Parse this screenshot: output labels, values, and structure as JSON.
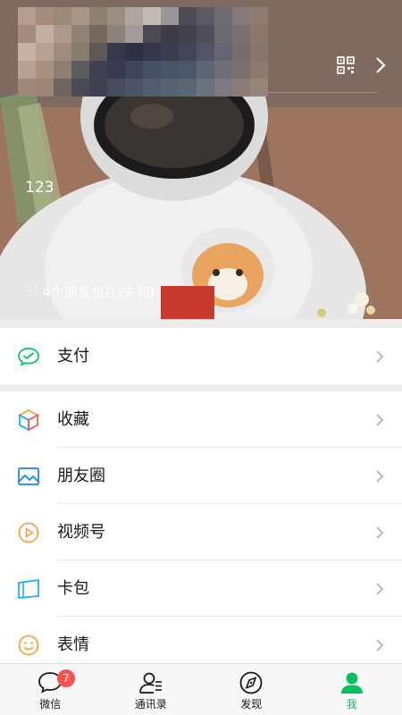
{
  "profile": {
    "status_text": "123",
    "friends_status": "4个朋友也在(未知)",
    "friends_status_prefix": "···"
  },
  "menu": {
    "pay": {
      "label": "支付",
      "icon": "wechat-pay-icon"
    },
    "items": [
      {
        "label": "收藏",
        "icon": "favorites-cube-icon"
      },
      {
        "label": "朋友圈",
        "icon": "moments-image-icon"
      },
      {
        "label": "视频号",
        "icon": "channels-play-icon"
      },
      {
        "label": "卡包",
        "icon": "card-wallet-icon"
      },
      {
        "label": "表情",
        "icon": "sticker-smile-icon"
      }
    ]
  },
  "tabbar": {
    "tabs": [
      {
        "label": "微信",
        "icon": "chat-bubble-icon",
        "badge": "7"
      },
      {
        "label": "通讯录",
        "icon": "contacts-icon"
      },
      {
        "label": "发现",
        "icon": "compass-icon"
      },
      {
        "label": "我",
        "icon": "person-icon",
        "active": true
      }
    ]
  },
  "colors": {
    "accent": "#07c160",
    "badge": "#fa5151",
    "background": "#ededed"
  }
}
